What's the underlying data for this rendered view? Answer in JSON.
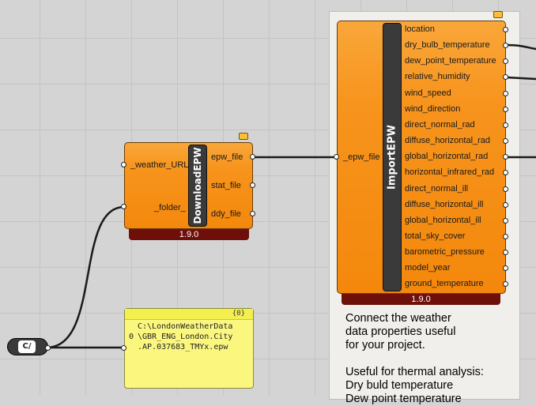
{
  "download": {
    "name": "DownloadEPW",
    "inputs": [
      "_weather_URL",
      "_folder_"
    ],
    "outputs": [
      "epw_file",
      "stat_file",
      "ddy_file"
    ],
    "version": "1.9.0"
  },
  "import": {
    "name": "ImportEPW",
    "input": "_epw_file",
    "outputs": [
      "location",
      "dry_bulb_temperature",
      "dew_point_temperature",
      "relative_humidity",
      "wind_speed",
      "wind_direction",
      "direct_normal_rad",
      "diffuse_horizontal_rad",
      "global_horizontal_rad",
      "horizontal_infrared_rad",
      "direct_normal_ill",
      "diffuse_horizontal_ill",
      "global_horizontal_ill",
      "total_sky_cover",
      "barometric_pressure",
      "model_year",
      "ground_temperature"
    ],
    "version": "1.9.0"
  },
  "panel": {
    "count": "{0}",
    "index": "0",
    "text": "C:\\LondonWeatherData\n\\GBR_ENG_London.City\n.AP.037683_TMYx.epw"
  },
  "note": {
    "text": "Connect the weather\ndata properties useful\nfor your project.\n\nUseful for thermal analysis:\nDry buld temperature\nDew point temperature"
  },
  "context_node": {
    "label": "C/"
  }
}
